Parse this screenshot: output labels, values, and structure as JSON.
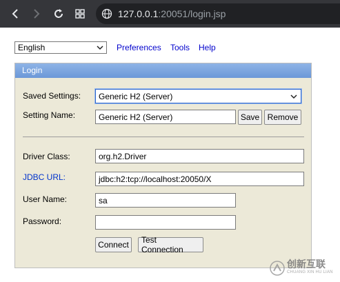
{
  "browser": {
    "url_host": "127.0.0.1",
    "url_rest": ":20051/login.jsp"
  },
  "top": {
    "language": "English",
    "links": [
      "Preferences",
      "Tools",
      "Help"
    ]
  },
  "login": {
    "title": "Login",
    "saved_settings_label": "Saved Settings:",
    "saved_settings_value": "Generic H2 (Server)",
    "setting_name_label": "Setting Name:",
    "setting_name_value": "Generic H2 (Server)",
    "save_label": "Save",
    "remove_label": "Remove",
    "driver_class_label": "Driver Class:",
    "driver_class_value": "org.h2.Driver",
    "jdbc_url_label": "JDBC URL:",
    "jdbc_url_value": "jdbc:h2:tcp://localhost:20050/X",
    "user_name_label": "User Name:",
    "user_name_value": "sa",
    "password_label": "Password:",
    "password_value": "",
    "connect_label": "Connect",
    "test_connection_label": "Test Connection"
  },
  "watermark": {
    "main": "创新互联",
    "sub": "CHUANG XIN HU LIAN"
  },
  "icons": [
    "back-icon",
    "forward-icon",
    "reload-icon",
    "apps-icon",
    "globe-icon",
    "chevron-down-icon"
  ]
}
